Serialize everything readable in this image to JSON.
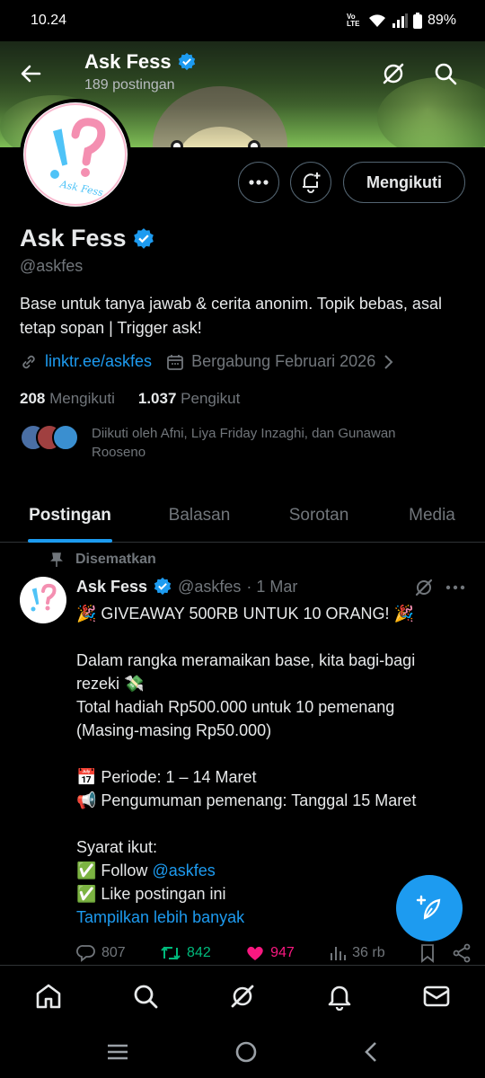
{
  "status_bar": {
    "time": "10.24",
    "battery": "89%",
    "volte": "Vo LTE"
  },
  "header": {
    "title": "Ask Fess",
    "subtitle": "189 postingan"
  },
  "profile": {
    "avatar_text": "Ask Fess",
    "name": "Ask Fess",
    "handle": "@askfes",
    "bio": "Base untuk tanya jawab & cerita anonim. Topik bebas, asal tetap sopan | Trigger ask!",
    "link": "linktr.ee/askfes",
    "joined": "Bergabung Februari 2026",
    "following_count": "208",
    "following_label": "Mengikuti",
    "followers_count": "1.037",
    "followers_label": "Pengikut",
    "followed_by": "Diikuti oleh Afni, Liya Friday Inzaghi, dan Gunawan Rooseno",
    "follow_button": "Mengikuti"
  },
  "tabs": [
    {
      "label": "Postingan",
      "active": true
    },
    {
      "label": "Balasan",
      "active": false
    },
    {
      "label": "Sorotan",
      "active": false
    },
    {
      "label": "Media",
      "active": false
    }
  ],
  "tweet": {
    "pinned_label": "Disematkan",
    "name": "Ask Fess",
    "handle": "@askfes",
    "date": "· 1 Mar",
    "lines": [
      "🎉 GIVEAWAY 500RB UNTUK 10 ORANG! 🎉",
      "",
      "Dalam rangka meramaikan base, kita bagi-bagi",
      "rezeki 💸",
      "Total hadiah Rp500.000 untuk 10 pemenang",
      "(Masing-masing Rp50.000)",
      "",
      "📅 Periode: 1 – 14 Maret",
      "📢 Pengumuman pemenang: Tanggal 15 Maret",
      "",
      "Syarat ikut:",
      "✅ Follow",
      "✅ Like postingan ini"
    ],
    "follow_mention": "@askfes",
    "show_more": "Tampilkan lebih banyak",
    "replies": "807",
    "retweets": "842",
    "likes": "947",
    "views": "36 rb"
  },
  "colors": {
    "accent": "#1d9bf0",
    "retweet": "#00ba7c",
    "like": "#f91880",
    "muted": "#71767b"
  }
}
